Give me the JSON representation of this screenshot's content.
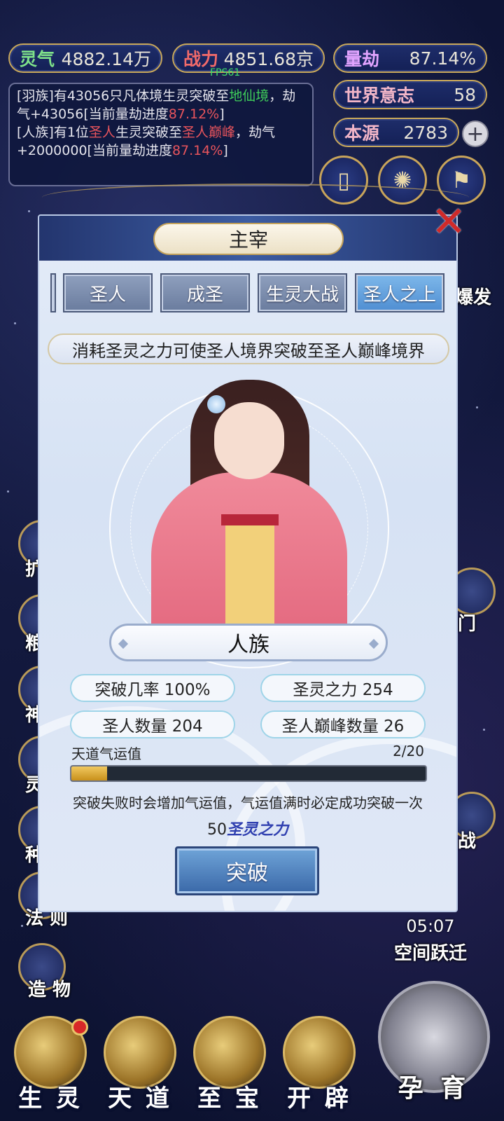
{
  "top_stats": {
    "lingqi": {
      "label": "灵气",
      "value": "4882.14万"
    },
    "zhanli": {
      "label": "战力",
      "value": "4851.68京"
    },
    "liangjie": {
      "label": "量劫",
      "value": "87.14%"
    },
    "shijie": {
      "label": "世界意志",
      "value": "58"
    },
    "benyuan": {
      "label": "本源",
      "value": "2783"
    }
  },
  "fps": "FPS61",
  "log": {
    "line1_a": "[羽族]有43056只凡体境生灵突破至",
    "line1_b": "地仙境",
    "line1_c": "，劫气+43056[当前量劫进度",
    "line1_d": "87.12%",
    "line1_e": "]",
    "line2_a": "[人族]有1位",
    "line2_b": "圣人",
    "line2_c": "生灵突破至",
    "line2_d": "圣人巅峰",
    "line2_e": "，劫气+2000000[当前量劫进度",
    "line2_f": "87.14%",
    "line2_g": "]"
  },
  "side_left": [
    "扩",
    "粮",
    "神",
    "灵",
    "种",
    "法 则",
    "造 物"
  ],
  "side_right": [
    "爆发",
    "门",
    "战"
  ],
  "timer": {
    "time": "05:07",
    "label": "空间跃迁"
  },
  "bottom_nav": [
    "生 灵",
    "天 道",
    "至 宝",
    "开 辟"
  ],
  "yunyu": "孕 育",
  "modal": {
    "title": "主宰",
    "close_icon": "✕",
    "tabs": [
      "圣人",
      "成圣",
      "生灵大战",
      "圣人之上"
    ],
    "active_tab": "圣人之上",
    "description": "消耗圣灵之力可使圣人境界突破至圣人巅峰境界",
    "race": "人族",
    "stats": {
      "rate": "突破几率 100%",
      "power": "圣灵之力 254",
      "saints": "圣人数量 204",
      "peak": "圣人巅峰数量 26"
    },
    "luck": {
      "label": "天道气运值",
      "count": "2/20",
      "current": 2,
      "max": 20
    },
    "hint": "突破失败时会增加气运值，气运值满时必定成功突破一次",
    "cost_amount": "50",
    "cost_item": "圣灵之力",
    "break_label": "突破"
  },
  "colors": {
    "accent_gold": "#c9a85a",
    "active_tab": "#4f8ed2",
    "log_green": "#3fce5a",
    "log_red": "#e8545c"
  }
}
